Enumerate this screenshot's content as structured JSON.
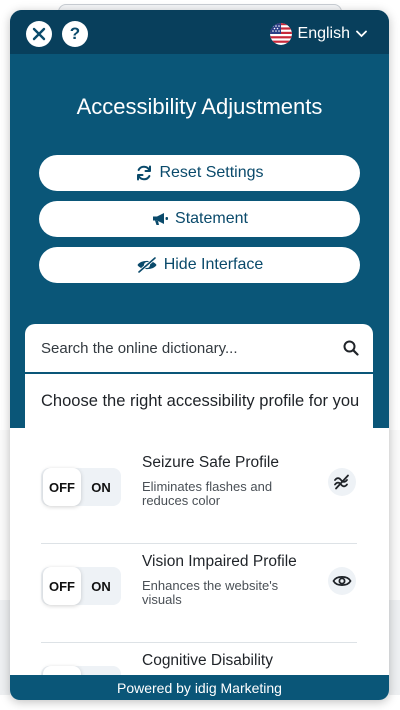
{
  "header": {
    "language": "English"
  },
  "hero": {
    "title": "Accessibility Adjustments",
    "buttons": {
      "reset": "Reset Settings",
      "statement": "Statement",
      "hide": "Hide Interface"
    }
  },
  "search": {
    "placeholder": "Search the online dictionary..."
  },
  "profiles": {
    "heading": "Choose the right accessibility profile for you",
    "toggle_off": "OFF",
    "toggle_on": "ON",
    "items": [
      {
        "title": "Seizure Safe Profile",
        "description": "Eliminates flashes and reduces color",
        "icon": "flash-off-icon",
        "state": "OFF"
      },
      {
        "title": "Vision Impaired Profile",
        "description": "Enhances the website's visuals",
        "icon": "eye-icon",
        "state": "OFF"
      },
      {
        "title": "Cognitive Disability",
        "description": "",
        "icon": "",
        "state": "OFF"
      }
    ]
  },
  "footer": {
    "text": "Powered by idig Marketing"
  },
  "colors": {
    "primary": "#0a5678",
    "topbar": "#083f5c",
    "text_on_primary": "#ffffff"
  }
}
